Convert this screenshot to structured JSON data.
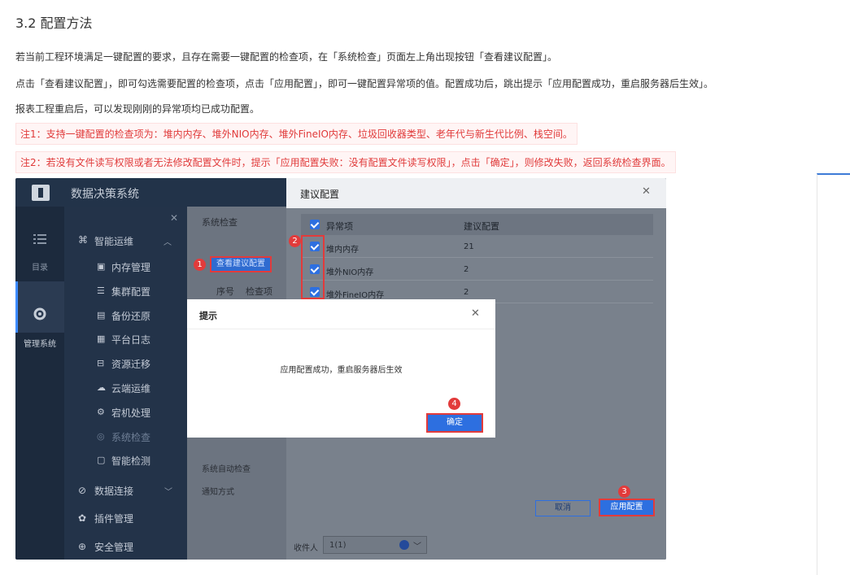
{
  "doc": {
    "section_title": "3.2 配置方法",
    "paragraphs": [
      "若当前工程环境满足一键配置的要求，且存在需要一键配置的检查项，在「系统检查」页面左上角出现按钮「查看建议配置」。",
      "点击「查看建议配置」，即可勾选需要配置的检查项，点击「应用配置」，即可一键配置异常项的值。配置成功后，跳出提示「应用配置成功，重启服务器后生效」。",
      "报表工程重启后，可以发现刚刚的异常项均已成功配置。"
    ],
    "notes": [
      "注1：支持一键配置的检查项为：堆内内存、堆外NIO内存、堆外FineIO内存、垃圾回收器类型、老年代与新生代比例、栈空间。",
      "注2：若没有文件读写权限或者无法修改配置文件时，提示「应用配置失败：没有配置文件读写权限」，点击「确定」，则修改失败，返回系统检查界面。"
    ]
  },
  "screenshot": {
    "app_title": "数据决策系统",
    "rail": [
      {
        "label": "目录",
        "icon": "list-icon"
      },
      {
        "label": "管理系统",
        "icon": "gear-icon"
      }
    ],
    "menu": {
      "group": {
        "label": "智能运维",
        "icon": "ops-icon"
      },
      "sub_items": [
        {
          "label": "内存管理",
          "icon": "memory-icon"
        },
        {
          "label": "集群配置",
          "icon": "cluster-icon"
        },
        {
          "label": "备份还原",
          "icon": "backup-icon"
        },
        {
          "label": "平台日志",
          "icon": "log-icon"
        },
        {
          "label": "资源迁移",
          "icon": "migrate-icon"
        },
        {
          "label": "云端运维",
          "icon": "cloud-icon"
        },
        {
          "label": "宕机处理",
          "icon": "crash-icon"
        },
        {
          "label": "系统检查",
          "icon": "check-icon"
        },
        {
          "label": "智能检测",
          "icon": "detect-icon"
        }
      ],
      "bottom_items": [
        {
          "label": "数据连接",
          "icon": "link-icon"
        },
        {
          "label": "插件管理",
          "icon": "plugin-icon"
        },
        {
          "label": "安全管理",
          "icon": "shield-icon"
        }
      ]
    },
    "content": {
      "tab_label": "系统检查",
      "view_button": "查看建议配置",
      "col_index": "序号",
      "col_item": "检查项",
      "auto_check": "系统自动检查",
      "notify": "通知方式",
      "receiver_label": "收件人",
      "receiver_value": "1(1)"
    },
    "suggest_dialog": {
      "title": "建议配置",
      "col_item": "异常项",
      "col_value": "建议配置",
      "rows": [
        {
          "item": "堆内内存",
          "value": "21"
        },
        {
          "item": "堆外NIO内存",
          "value": "2"
        },
        {
          "item": "堆外FineIO内存",
          "value": "2"
        }
      ],
      "cancel": "取消",
      "apply": "应用配置"
    },
    "tip_dialog": {
      "title": "提示",
      "message": "应用配置成功，重启服务器后生效",
      "ok": "确定"
    },
    "badges": [
      "1",
      "2",
      "3",
      "4"
    ],
    "colors": {
      "accent": "#2d6fe0",
      "highlight": "#e23b3b",
      "note_text": "#e03a3a"
    }
  }
}
